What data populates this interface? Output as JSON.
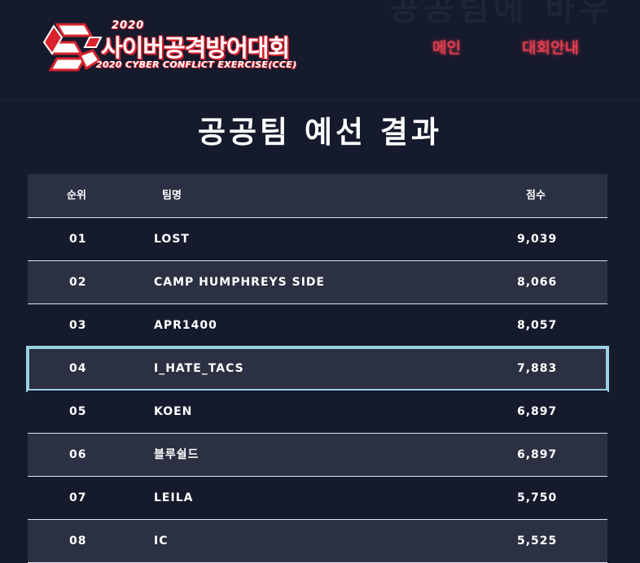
{
  "header": {
    "ghost_text": "공공팀에 바우",
    "logo": {
      "year": "2020",
      "title": "사이버공격방어대회",
      "subtitle": "2020 CYBER CONFLICT EXERCISE(CCE)"
    },
    "nav": [
      {
        "label": "메인"
      },
      {
        "label": "대회안내"
      }
    ]
  },
  "page_title": "공공팀 예선 결과",
  "table": {
    "columns": {
      "rank": "순위",
      "team": "팀명",
      "score": "점수"
    },
    "rows": [
      {
        "rank": "01",
        "team": "LOST",
        "score": "9,039"
      },
      {
        "rank": "02",
        "team": "CAMP HUMPHREYS SIDE",
        "score": "8,066"
      },
      {
        "rank": "03",
        "team": "APR1400",
        "score": "8,057"
      },
      {
        "rank": "04",
        "team": "I_HATE_TACS",
        "score": "7,883"
      },
      {
        "rank": "05",
        "team": "KOEN",
        "score": "6,897"
      },
      {
        "rank": "06",
        "team": "블루쉴드",
        "score": "6,897"
      },
      {
        "rank": "07",
        "team": "LEILA",
        "score": "5,750"
      },
      {
        "rank": "08",
        "team": "IC",
        "score": "5,525"
      }
    ],
    "highlighted_rank": "04"
  },
  "colors": {
    "background": "#151a2c",
    "row_alt": "#2b3042",
    "highlight_border": "#9ad0e2",
    "nav_neon": "#f23a4c",
    "logo_red": "#d8232e"
  }
}
